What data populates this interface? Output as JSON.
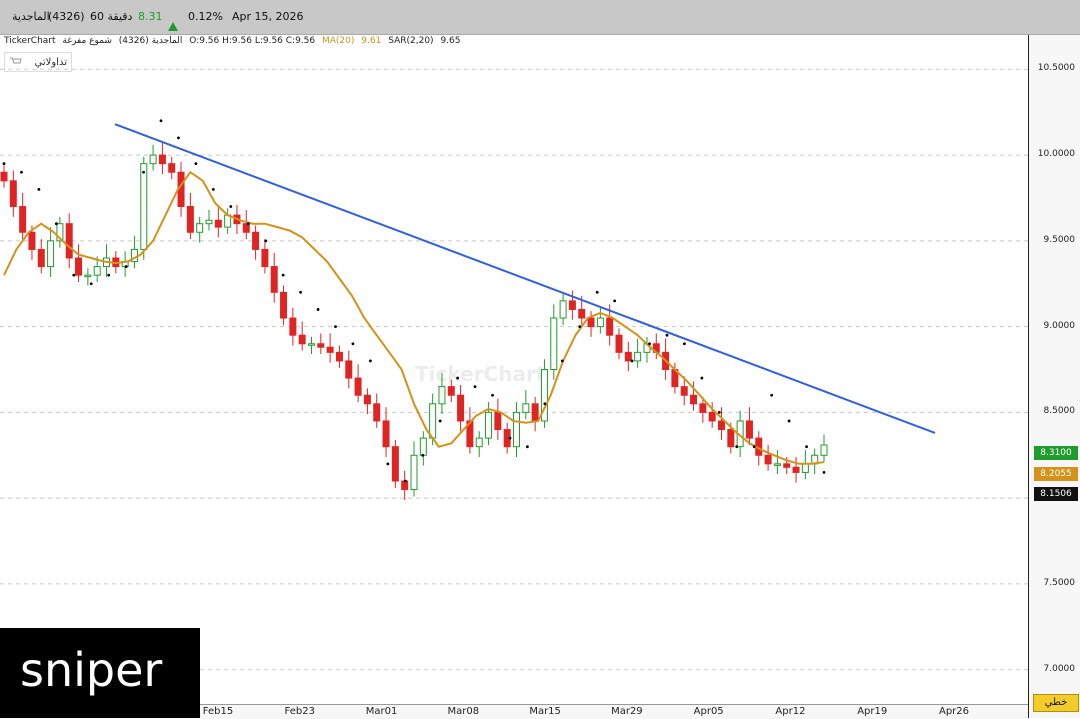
{
  "header": {
    "name": "الماجدية",
    "code": "(4326)",
    "tick_label": "60 دقيقة",
    "last_price": "8.31",
    "change_pct": "0.12%",
    "date": "Apr 15, 2026"
  },
  "info": {
    "brand": "TickerChart",
    "symbol": "الماجدية (4326)",
    "chart_kind": "شموع مفرغة",
    "ohlc": "O:9.56  H:9.56  L:9.56  C:9.56",
    "ma_label": "MA(20)",
    "ma_value": "9.61",
    "sar_label": "SAR(2,20)",
    "sar_value": "9.65"
  },
  "tadawulaty_button": "تداولاتي",
  "line_button": "خطي",
  "watermark": "TickerChart",
  "overlay_text": "sniper",
  "colors": {
    "up": "#1f9d2c",
    "down": "#e02424",
    "ma": "#d4921a",
    "trend": "#3060e0",
    "sar": "#000000"
  },
  "chart_data": {
    "type": "candlestick",
    "y_ticks": [
      "10.5000",
      "10.0000",
      "9.5000",
      "9.0000",
      "8.5000",
      "8.0000",
      "7.5000",
      "7.0000"
    ],
    "ylim": [
      6.8,
      10.7
    ],
    "x_ticks": [
      "Feb15",
      "Feb23",
      "Mar01",
      "Mar08",
      "Mar15",
      "Mar29",
      "Apr05",
      "Apr12",
      "Apr19",
      "Apr26"
    ],
    "price_labels": {
      "last": "8.3100",
      "ma": "8.2055",
      "sar": "8.1506"
    },
    "closes": [
      9.85,
      9.7,
      9.55,
      9.45,
      9.35,
      9.5,
      9.6,
      9.4,
      9.3,
      9.3,
      9.35,
      9.4,
      9.35,
      9.38,
      9.45,
      9.95,
      10.0,
      9.95,
      9.9,
      9.7,
      9.55,
      9.6,
      9.62,
      9.58,
      9.65,
      9.6,
      9.55,
      9.45,
      9.35,
      9.2,
      9.05,
      8.95,
      8.9,
      8.9,
      8.88,
      8.85,
      8.8,
      8.7,
      8.6,
      8.55,
      8.45,
      8.3,
      8.1,
      8.05,
      8.25,
      8.35,
      8.55,
      8.65,
      8.6,
      8.45,
      8.3,
      8.35,
      8.5,
      8.4,
      8.3,
      8.5,
      8.55,
      8.45,
      8.75,
      9.05,
      9.15,
      9.1,
      9.05,
      9.0,
      9.05,
      8.95,
      8.85,
      8.8,
      8.85,
      8.9,
      8.85,
      8.75,
      8.65,
      8.6,
      8.55,
      8.5,
      8.45,
      8.4,
      8.3,
      8.45,
      8.35,
      8.25,
      8.2,
      8.2,
      8.18,
      8.15,
      8.2,
      8.25,
      8.31
    ],
    "ma": [
      9.3,
      9.45,
      9.55,
      9.6,
      9.55,
      9.48,
      9.42,
      9.4,
      9.38,
      9.37,
      9.38,
      9.42,
      9.5,
      9.65,
      9.8,
      9.9,
      9.85,
      9.72,
      9.65,
      9.62,
      9.6,
      9.6,
      9.58,
      9.56,
      9.52,
      9.45,
      9.38,
      9.28,
      9.18,
      9.05,
      8.95,
      8.85,
      8.75,
      8.55,
      8.4,
      8.3,
      8.32,
      8.4,
      8.48,
      8.52,
      8.5,
      8.45,
      8.44,
      8.45,
      8.6,
      8.8,
      8.95,
      9.05,
      9.08,
      9.05,
      9.0,
      8.95,
      8.88,
      8.82,
      8.75,
      8.68,
      8.6,
      8.52,
      8.45,
      8.38,
      8.32,
      8.28,
      8.25,
      8.22,
      8.2,
      8.2,
      8.21
    ],
    "sar": [
      9.95,
      9.9,
      9.8,
      9.6,
      9.3,
      9.25,
      9.3,
      9.35,
      9.9,
      10.2,
      10.1,
      9.95,
      9.8,
      9.7,
      9.6,
      9.5,
      9.3,
      9.2,
      9.1,
      9.0,
      8.9,
      8.8,
      8.2,
      8.1,
      8.25,
      8.45,
      8.7,
      8.65,
      8.6,
      8.35,
      8.3,
      8.55,
      8.8,
      9.0,
      9.2,
      9.15,
      8.8,
      8.9,
      8.95,
      8.9,
      8.7,
      8.5,
      8.3,
      8.3,
      8.6,
      8.45,
      8.3,
      8.15
    ],
    "trendline": {
      "start": [
        0,
        10.18
      ],
      "end": [
        1,
        8.38
      ]
    }
  }
}
